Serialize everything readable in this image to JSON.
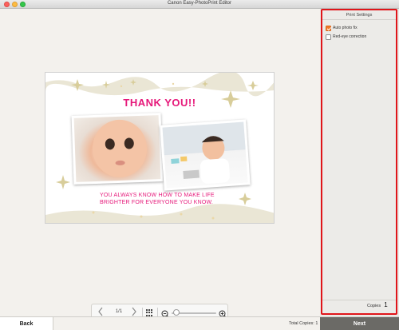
{
  "window": {
    "title": "Canon Easy-PhotoPrint Editor"
  },
  "card": {
    "title": "THANK YOU!!",
    "message_line1": "YOU ALWAYS KNOW HOW TO MAKE LIFE",
    "message_line2": "BRIGHTER FOR EVERYONE YOU KNOW."
  },
  "navigation": {
    "prev_icon": "chevron-left-icon",
    "next_icon": "chevron-right-icon",
    "page_indicator": "1/1",
    "thumbnails_icon": "grid-icon",
    "zoom_out_icon": "zoom-out-icon",
    "zoom_in_icon": "zoom-in-icon",
    "zoom_level": 0.05
  },
  "sidebar": {
    "header": "Print Settings",
    "options": [
      {
        "label": "Auto photo fix",
        "checked": true
      },
      {
        "label": "Red-eye correction",
        "checked": false
      }
    ],
    "copies_label": "Copies",
    "copies_value": "1"
  },
  "footer": {
    "back_label": "Back",
    "total_copies": "Total Copies: 1",
    "next_label": "Next"
  },
  "colors": {
    "accent_pink": "#e6187a",
    "highlight_red": "#e0151a",
    "checkbox_orange": "#f07a2b",
    "next_button": "#6b6a66"
  }
}
